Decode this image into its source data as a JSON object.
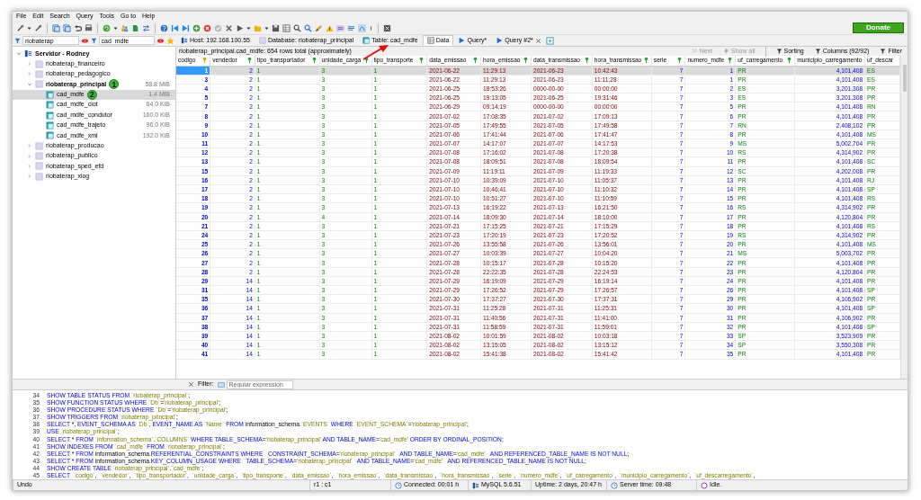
{
  "menu": [
    "File",
    "Edit",
    "Search",
    "Query",
    "Tools",
    "Go to",
    "Help"
  ],
  "donate_button": "Donate",
  "tree_filters": [
    {
      "value": "riobaterap"
    },
    {
      "value": "cad_mdfe"
    }
  ],
  "tabs": [
    {
      "kind": "host",
      "label": "Host: 192.168.100.55",
      "selected": false
    },
    {
      "kind": "database",
      "label": "Database: riobaterap_principal",
      "selected": false
    },
    {
      "kind": "table",
      "label": "Table: cad_mdfe",
      "selected": false
    },
    {
      "kind": "data",
      "label": "Data",
      "selected": true
    },
    {
      "kind": "query",
      "label": "Query*",
      "selected": false,
      "closable": false
    },
    {
      "kind": "query",
      "label": "Query #2*",
      "selected": false,
      "closable": true
    }
  ],
  "tree": {
    "label": "Servidor - Rodney",
    "expanded": true,
    "children": [
      {
        "label": "riobaterap_financeiro",
        "expanded": false,
        "active": false,
        "selected": false
      },
      {
        "label": "riobaterap_pedagogico",
        "expanded": false,
        "active": false,
        "selected": false
      },
      {
        "label": "riobaterap_principal",
        "size": "58.8 MiB",
        "expanded": true,
        "active": true,
        "selected": false,
        "annotation": "1",
        "children": [
          {
            "label": "cad_mdfe",
            "size": "1.4 MiB",
            "selected": true,
            "annotation": "2"
          },
          {
            "label": "cad_mdfe_ciot",
            "size": "64.0 KiB",
            "selected": false
          },
          {
            "label": "cad_mdfe_condutor",
            "size": "160.0 KiB",
            "selected": false
          },
          {
            "label": "cad_mdfe_trajeto",
            "size": "96.0 KiB",
            "selected": false
          },
          {
            "label": "cad_mdfe_xml",
            "size": "192.0 KiB",
            "selected": false
          }
        ]
      },
      {
        "label": "riobaterap_producao",
        "expanded": false,
        "active": false,
        "selected": false
      },
      {
        "label": "riobaterap_publico",
        "expanded": false,
        "active": false,
        "selected": false
      },
      {
        "label": "riobaterap_sped_efd",
        "expanded": false,
        "active": false,
        "selected": false
      },
      {
        "label": "riobaterap_xlog",
        "expanded": false,
        "active": false,
        "selected": false
      }
    ]
  },
  "grid": {
    "caption": "riobaterap_principal.cad_mdfe: 654 rows total (approximately)",
    "actions": [
      {
        "kind": "next",
        "label": "Next",
        "disabled": true
      },
      {
        "kind": "showall",
        "label": "Show all",
        "disabled": true
      },
      {
        "kind": "menu",
        "label": "Sorting",
        "disabled": false
      },
      {
        "kind": "menu",
        "label": "Columns (92/92)",
        "disabled": false
      },
      {
        "kind": "menu",
        "label": "Filter",
        "disabled": false
      }
    ],
    "columns": [
      {
        "name": "codigo",
        "kind": "number"
      },
      {
        "name": "vendedor",
        "kind": "number"
      },
      {
        "name": "tipo_transportador",
        "kind": "text"
      },
      {
        "name": "unidade_carga",
        "kind": "text"
      },
      {
        "name": "tipo_transporte",
        "kind": "text"
      },
      {
        "name": "data_emissao",
        "kind": "date"
      },
      {
        "name": "hora_emissao",
        "kind": "date"
      },
      {
        "name": "data_transmissao",
        "kind": "date"
      },
      {
        "name": "hora_transmissao",
        "kind": "date"
      },
      {
        "name": "serie",
        "kind": "number"
      },
      {
        "name": "numero_mdfe",
        "kind": "number"
      },
      {
        "name": "uf_carregamento",
        "kind": "text"
      },
      {
        "name": "municipio_carregamento",
        "kind": "number"
      },
      {
        "name": "uf_descar",
        "kind": "text"
      }
    ],
    "rows": [
      {
        "selected": true,
        "cells": [
          "1",
          "2",
          "1",
          "3",
          "1",
          "2021-06-22",
          "11:29:13",
          "2021-06-23",
          "10:42:43",
          "7",
          "1",
          "PR",
          "4,101,408",
          "ES"
        ]
      },
      {
        "selected": false,
        "cells": [
          "3",
          "2",
          "1",
          "3",
          "1",
          "2021-06-22",
          "11:29:13",
          "2021-06-23",
          "11:11:28",
          "7",
          "1",
          "PR",
          "4,101,408",
          "ES"
        ]
      },
      {
        "selected": false,
        "cells": [
          "4",
          "2",
          "1",
          "3",
          "1",
          "2021-06-25",
          "18:53:26",
          "0000-00-00",
          "00:00:00",
          "7",
          "2",
          "ES",
          "3,201,308",
          "PR"
        ]
      },
      {
        "selected": false,
        "cells": [
          "5",
          "2",
          "1",
          "3",
          "1",
          "2021-06-25",
          "19:13:05",
          "2021-06-25",
          "19:31:46",
          "7",
          "3",
          "ES",
          "3,201,308",
          "PR"
        ]
      },
      {
        "selected": false,
        "cells": [
          "7",
          "2",
          "1",
          "3",
          "1",
          "2021-06-29",
          "09:14:19",
          "0000-00-00",
          "00:00:00",
          "7",
          "5",
          "PR",
          "4,101,408",
          "RN"
        ]
      },
      {
        "selected": false,
        "cells": [
          "8",
          "2",
          "1",
          "3",
          "1",
          "2021-07-02",
          "17:08:35",
          "2021-07-02",
          "17:09:13",
          "7",
          "6",
          "PR",
          "4,101,408",
          "PR"
        ]
      },
      {
        "selected": false,
        "cells": [
          "9",
          "2",
          "1",
          "3",
          "1",
          "2021-07-05",
          "17:49:55",
          "2021-07-05",
          "17:49:58",
          "7",
          "7",
          "RN",
          "2,408,102",
          "PR"
        ]
      },
      {
        "selected": false,
        "cells": [
          "10",
          "2",
          "1",
          "3",
          "1",
          "2021-07-06",
          "17:41:44",
          "2021-07-06",
          "17:41:47",
          "7",
          "8",
          "PR",
          "4,101,408",
          "MS"
        ]
      },
      {
        "selected": false,
        "cells": [
          "11",
          "2",
          "1",
          "3",
          "1",
          "2021-07-07",
          "14:17:07",
          "2021-07-07",
          "14:17:53",
          "7",
          "9",
          "MS",
          "5,002,704",
          "PR"
        ]
      },
      {
        "selected": false,
        "cells": [
          "12",
          "2",
          "1",
          "3",
          "1",
          "2021-07-08",
          "17:16:02",
          "2021-07-08",
          "17:20:38",
          "7",
          "10",
          "RS",
          "4,314,902",
          "PR"
        ]
      },
      {
        "selected": false,
        "cells": [
          "13",
          "2",
          "1",
          "3",
          "1",
          "2021-07-08",
          "18:09:51",
          "2021-07-08",
          "18:09:54",
          "7",
          "11",
          "PR",
          "4,101,408",
          "SC"
        ]
      },
      {
        "selected": false,
        "cells": [
          "15",
          "2",
          "1",
          "3",
          "1",
          "2021-07-09",
          "11:19:11",
          "2021-07-09",
          "11:19:33",
          "7",
          "12",
          "SC",
          "4,202,008",
          "PR"
        ]
      },
      {
        "selected": false,
        "cells": [
          "16",
          "2",
          "1",
          "3",
          "1",
          "2021-07-10",
          "10:39:09",
          "2021-07-10",
          "11:05:37",
          "7",
          "13",
          "PR",
          "4,101,408",
          "RJ"
        ]
      },
      {
        "selected": false,
        "cells": [
          "17",
          "2",
          "1",
          "3",
          "1",
          "2021-07-10",
          "10:46:41",
          "2021-07-10",
          "11:10:32",
          "7",
          "14",
          "PR",
          "4,101,408",
          "SP"
        ]
      },
      {
        "selected": false,
        "cells": [
          "18",
          "2",
          "1",
          "3",
          "1",
          "2021-07-10",
          "10:51:27",
          "2021-07-10",
          "11:10:59",
          "7",
          "15",
          "PR",
          "4,101,408",
          "RS"
        ]
      },
      {
        "selected": false,
        "cells": [
          "19",
          "2",
          "1",
          "3",
          "1",
          "2021-07-13",
          "16:19:22",
          "2021-07-13",
          "16:21:50",
          "7",
          "16",
          "RS",
          "4,314,902",
          "PR"
        ]
      },
      {
        "selected": false,
        "cells": [
          "20",
          "2",
          "1",
          "4",
          "1",
          "2021-07-14",
          "18:09:30",
          "2021-07-14",
          "18:10:00",
          "7",
          "17",
          "PR",
          "4,120,804",
          "PR"
        ]
      },
      {
        "selected": false,
        "cells": [
          "21",
          "2",
          "1",
          "3",
          "1",
          "2021-07-21",
          "17:15:25",
          "2021-07-21",
          "17:15:29",
          "7",
          "18",
          "PR",
          "4,101,408",
          "RS"
        ]
      },
      {
        "selected": false,
        "cells": [
          "24",
          "2",
          "1",
          "3",
          "1",
          "2021-07-23",
          "17:20:19",
          "2021-07-23",
          "17:20:52",
          "7",
          "19",
          "RS",
          "4,314,902",
          "PR"
        ]
      },
      {
        "selected": false,
        "cells": [
          "25",
          "2",
          "1",
          "3",
          "1",
          "2021-07-26",
          "13:55:58",
          "2021-07-26",
          "13:56:01",
          "7",
          "20",
          "PR",
          "4,101,408",
          "MS"
        ]
      },
      {
        "selected": false,
        "cells": [
          "26",
          "2",
          "1",
          "3",
          "1",
          "2021-07-27",
          "10:03:39",
          "2021-07-27",
          "10:04:20",
          "7",
          "21",
          "MS",
          "5,003,702",
          "PR"
        ]
      },
      {
        "selected": false,
        "cells": [
          "27",
          "2",
          "1",
          "3",
          "1",
          "2021-07-28",
          "10:15:17",
          "2021-07-28",
          "10:15:20",
          "7",
          "22",
          "PR",
          "4,101,408",
          "PR"
        ]
      },
      {
        "selected": false,
        "cells": [
          "28",
          "2",
          "1",
          "3",
          "1",
          "2021-07-28",
          "22:22:35",
          "2021-07-28",
          "22:24:53",
          "7",
          "23",
          "PR",
          "4,120,804",
          "PR"
        ]
      },
      {
        "selected": false,
        "cells": [
          "29",
          "14",
          "1",
          "3",
          "1",
          "2021-07-29",
          "16:19:09",
          "2021-07-29",
          "16:19:14",
          "7",
          "24",
          "PR",
          "4,101,408",
          "PR"
        ]
      },
      {
        "selected": false,
        "cells": [
          "31",
          "14",
          "1",
          "3",
          "1",
          "2021-07-29",
          "17:26:52",
          "2021-07-29",
          "17:26:57",
          "7",
          "26",
          "PR",
          "4,101,408",
          "SP"
        ]
      },
      {
        "selected": false,
        "cells": [
          "35",
          "14",
          "1",
          "3",
          "1",
          "2021-07-30",
          "17:37:27",
          "2021-07-30",
          "17:37:31",
          "7",
          "29",
          "PR",
          "4,106,902",
          "PR"
        ]
      },
      {
        "selected": false,
        "cells": [
          "36",
          "14",
          "1",
          "3",
          "1",
          "2021-07-31",
          "11:25:28",
          "2021-07-31",
          "11:25:31",
          "7",
          "30",
          "PR",
          "4,101,408",
          "SP"
        ]
      },
      {
        "selected": false,
        "cells": [
          "37",
          "14",
          "1",
          "3",
          "1",
          "2021-07-31",
          "11:40:56",
          "2021-07-31",
          "11:41:00",
          "7",
          "31",
          "PR",
          "4,106,902",
          "PR"
        ]
      },
      {
        "selected": false,
        "cells": [
          "38",
          "14",
          "1",
          "3",
          "1",
          "2021-07-31",
          "11:58:59",
          "2021-07-31",
          "11:59:01",
          "7",
          "32",
          "PR",
          "4,101,408",
          "SP"
        ]
      },
      {
        "selected": false,
        "cells": [
          "39",
          "14",
          "1",
          "3",
          "1",
          "2021-08-02",
          "10:01:59",
          "2021-08-02",
          "10:03:18",
          "7",
          "33",
          "SP",
          "3,523,909",
          "PR"
        ]
      },
      {
        "selected": false,
        "cells": [
          "40",
          "14",
          "1",
          "3",
          "1",
          "2021-08-02",
          "13:15:05",
          "2021-08-02",
          "13:15:12",
          "7",
          "34",
          "SP",
          "3,550,308",
          "PR"
        ]
      },
      {
        "selected": false,
        "cells": [
          "41",
          "14",
          "1",
          "3",
          "1",
          "2021-08-02",
          "15:41:38",
          "2021-08-02",
          "15:41:42",
          "7",
          "35",
          "PR",
          "4,101,408",
          "PR"
        ]
      }
    ]
  },
  "filter_bar": {
    "label": "Filter:",
    "placeholder": "Regular expression"
  },
  "sql_log": [
    {
      "line": "34",
      "sql": "SHOW TABLE STATUS FROM `riobaterap_principal`;"
    },
    {
      "line": "35",
      "sql": "SHOW FUNCTION STATUS WHERE `Db`='riobaterap_principal';"
    },
    {
      "line": "36",
      "sql": "SHOW PROCEDURE STATUS WHERE `Db`='riobaterap_principal';"
    },
    {
      "line": "37",
      "sql": "SHOW TRIGGERS FROM `riobaterap_principal`;"
    },
    {
      "line": "38",
      "sql": "SELECT *, EVENT_SCHEMA AS `Db`, EVENT_NAME AS `Name` FROM information_schema.`EVENTS` WHERE `EVENT_SCHEMA`='riobaterap_principal';"
    },
    {
      "line": "39",
      "sql": "USE `riobaterap_principal`;"
    },
    {
      "line": "40",
      "sql": "SELECT * FROM `information_schema`.`COLUMNS` WHERE TABLE_SCHEMA='riobaterap_principal' AND TABLE_NAME='cad_mdfe' ORDER BY ORDINAL_POSITION;"
    },
    {
      "line": "41",
      "sql": "SHOW INDEXES FROM `cad_mdfe` FROM `riobaterap_principal`;"
    },
    {
      "line": "42",
      "sql": "SELECT * FROM information_schema.REFERENTIAL_CONSTRAINTS WHERE   CONSTRAINT_SCHEMA='riobaterap_principal'   AND TABLE_NAME='cad_mdfe'   AND REFERENCED_TABLE_NAME IS NOT NULL;"
    },
    {
      "line": "43",
      "sql": "SELECT * FROM information_schema.KEY_COLUMN_USAGE WHERE   TABLE_SCHEMA='riobaterap_principal'   AND TABLE_NAME='cad_mdfe'   AND REFERENCED_TABLE_NAME IS NOT NULL;"
    },
    {
      "line": "44",
      "sql": "SHOW CREATE TABLE `riobaterap_principal`.`cad_mdfe`;"
    },
    {
      "line": "45",
      "sql": "SELECT  `codigo`,  `vendedor`,  `tipo_transportador`,  `unidade_carga`,  `tipo_transporte`,  `data_emissao`,  `hora_emissao`,  `data_transmissao`,  `hora_transmissao`,  `serie`,  `numero_mdfe`,  `uf_carregamento`,  `municipio_carregamento`,  `uf_descarregamento`,"
    }
  ],
  "status_bar": [
    {
      "kind": "text",
      "label": "Undo"
    },
    {
      "kind": "text",
      "label": "r1 : c1"
    },
    {
      "kind": "clock",
      "label": "Connected: 00:01 h"
    },
    {
      "kind": "server",
      "label": "MySQL 5.6.51"
    },
    {
      "kind": "text",
      "label": "Uptime: 2 days, 20:47 h"
    },
    {
      "kind": "clock",
      "label": "Server time: 09:48"
    },
    {
      "kind": "idle",
      "label": "Idle."
    }
  ]
}
